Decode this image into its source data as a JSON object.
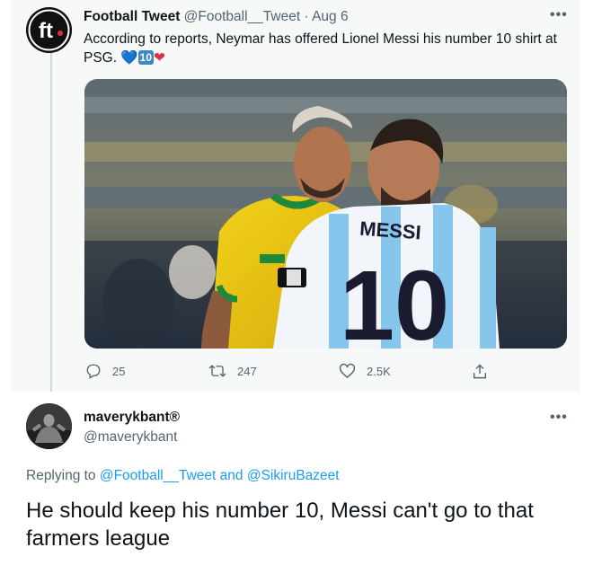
{
  "parent_tweet": {
    "author_name": "Football Tweet",
    "author_handle": "@Football__Tweet",
    "separator": "·",
    "date": "Aug 6",
    "avatar_text": "ft",
    "text": "According to reports, Neymar has offered Lionel Messi his number 10 shirt at PSG.",
    "emojis": {
      "blue_heart": "💙",
      "ten": "10",
      "red_heart": "❤"
    },
    "photo": {
      "jersey_name": "MESSI",
      "jersey_number": "10"
    },
    "stats": {
      "replies": "25",
      "retweets": "247",
      "likes": "2.5K"
    },
    "more_icon": "•••"
  },
  "reply_tweet": {
    "author_name": "maverykbant",
    "verified_mark": "®",
    "author_handle": "@maverykbant",
    "replying_prefix": "Replying to",
    "replying_user1": "@Football__Tweet",
    "replying_and": "and",
    "replying_user2": "@SikiruBazeet",
    "text": "He should keep his number 10, Messi can't go to that farmers league",
    "more_icon": "•••"
  },
  "colors": {
    "link": "#1d9bf0",
    "muted": "#536471",
    "parent_bg": "#f7f9f9",
    "thread_line": "#cfd9de"
  }
}
